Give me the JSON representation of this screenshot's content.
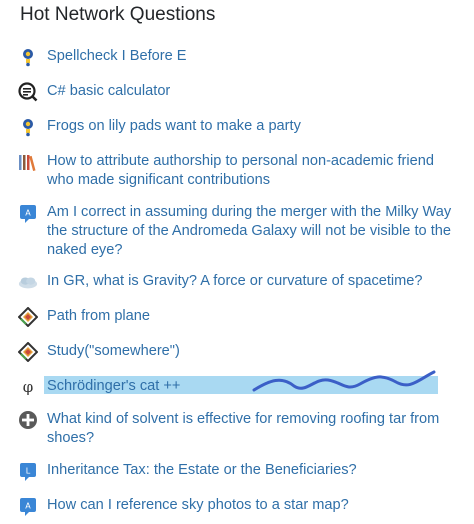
{
  "header": {
    "title": "Hot Network Questions"
  },
  "questions": [
    {
      "text": "Spellcheck I Before E",
      "icon": "puzzling-icon"
    },
    {
      "text": "C# basic calculator",
      "icon": "code-review-icon"
    },
    {
      "text": "Frogs on lily pads want to make a party",
      "icon": "puzzling-icon"
    },
    {
      "text": "How to attribute authorship to personal non-academic friend who made significant contributions",
      "icon": "academia-icon"
    },
    {
      "text": "Am I correct in assuming during the merger with the Milky Way the structure of the Andromeda Galaxy will not be visible to the naked eye?",
      "icon": "astronomy-icon"
    },
    {
      "text": "In GR, what is Gravity? A force or curvature of spacetime?",
      "icon": "physics-icon"
    },
    {
      "text": "Path from plane",
      "icon": "code-golf-icon"
    },
    {
      "text": "Study(\"somewhere\")",
      "icon": "code-golf-icon"
    },
    {
      "text": "Schrödinger's cat ++",
      "icon": "phi-icon"
    },
    {
      "text": "What kind of solvent is effective for removing roofing tar from shoes?",
      "icon": "lifehacks-icon"
    },
    {
      "text": "Inheritance Tax: the Estate or the Beneficiaries?",
      "icon": "law-icon"
    },
    {
      "text": "How can I reference sky photos to a star map?",
      "icon": "astronomy-icon"
    }
  ],
  "colors": {
    "link": "#2f6fa8",
    "highlight": "#a9d9f2",
    "scribble": "#3b5fc7"
  }
}
